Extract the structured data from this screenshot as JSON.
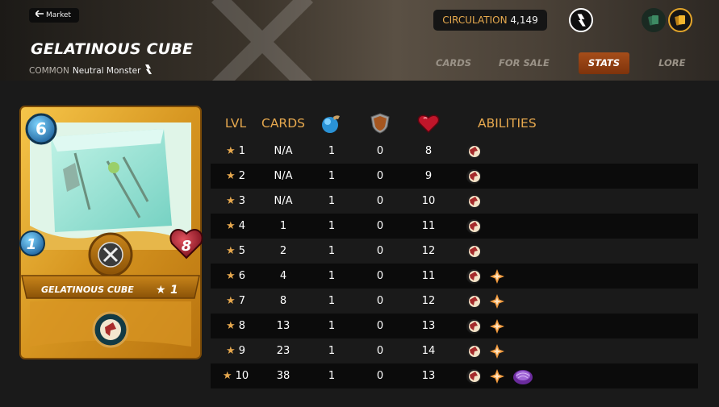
{
  "header": {
    "back_label": "Market",
    "title": "GELATINOUS CUBE",
    "rarity": "COMMON",
    "card_type": "Neutral Monster",
    "circulation_label": "CIRCULATION",
    "circulation_value": "4,149",
    "tabs": [
      {
        "label": "CARDS",
        "active": false
      },
      {
        "label": "FOR SALE",
        "active": false
      },
      {
        "label": "STATS",
        "active": true
      },
      {
        "label": "LORE",
        "active": false
      }
    ]
  },
  "card": {
    "mana": "6",
    "speed": "1",
    "health": "8",
    "name": "GELATINOUS CUBE",
    "level_star": "★",
    "level": "1",
    "ability_icon": "scavenger-icon"
  },
  "table": {
    "headers": {
      "lvl": "LVL",
      "cards": "CARDS",
      "abilities": "ABILITIES"
    },
    "header_icons": [
      "speed-icon",
      "armor-icon",
      "health-icon"
    ],
    "star": "★",
    "rows": [
      {
        "lvl": "1",
        "cards": "N/A",
        "speed": "1",
        "armor": "0",
        "health": "8",
        "abilities": [
          "scavenger"
        ]
      },
      {
        "lvl": "2",
        "cards": "N/A",
        "speed": "1",
        "armor": "0",
        "health": "9",
        "abilities": [
          "scavenger"
        ]
      },
      {
        "lvl": "3",
        "cards": "N/A",
        "speed": "1",
        "armor": "0",
        "health": "10",
        "abilities": [
          "scavenger"
        ]
      },
      {
        "lvl": "4",
        "cards": "1",
        "speed": "1",
        "armor": "0",
        "health": "11",
        "abilities": [
          "scavenger"
        ]
      },
      {
        "lvl": "5",
        "cards": "2",
        "speed": "1",
        "armor": "0",
        "health": "12",
        "abilities": [
          "scavenger"
        ]
      },
      {
        "lvl": "6",
        "cards": "4",
        "speed": "1",
        "armor": "0",
        "health": "11",
        "abilities": [
          "scavenger",
          "spark"
        ]
      },
      {
        "lvl": "7",
        "cards": "8",
        "speed": "1",
        "armor": "0",
        "health": "12",
        "abilities": [
          "scavenger",
          "spark"
        ]
      },
      {
        "lvl": "8",
        "cards": "13",
        "speed": "1",
        "armor": "0",
        "health": "13",
        "abilities": [
          "scavenger",
          "spark"
        ]
      },
      {
        "lvl": "9",
        "cards": "23",
        "speed": "1",
        "armor": "0",
        "health": "14",
        "abilities": [
          "scavenger",
          "spark"
        ]
      },
      {
        "lvl": "10",
        "cards": "38",
        "speed": "1",
        "armor": "0",
        "health": "13",
        "abilities": [
          "scavenger",
          "spark",
          "shell"
        ]
      }
    ]
  },
  "colors": {
    "accent": "#e6a84e",
    "active_tab": "#8f3f12",
    "card_gold": "#d9982a",
    "row_dark": "#0b0b0b"
  }
}
